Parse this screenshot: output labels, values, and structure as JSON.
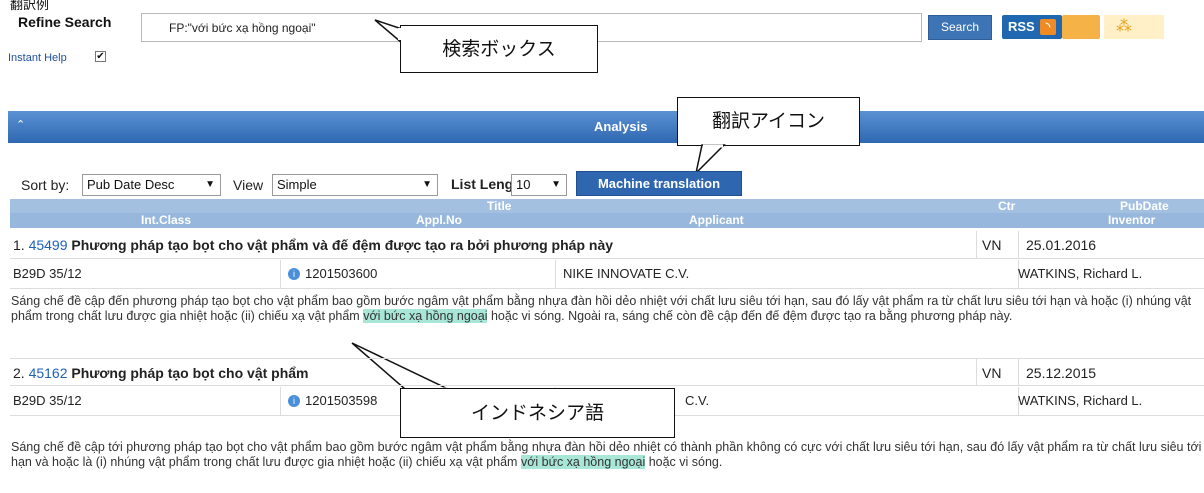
{
  "top_caption": "翻訳例",
  "search": {
    "label": "Refine Search",
    "query": "FP:\"với bức xạ hồng ngoại\"",
    "button": "Search",
    "rss_label": "RSS",
    "rss_glyph": "rss-icon",
    "tree_glyph": "tree-icon",
    "instant_help": "Instant Help",
    "instant_help_checked": "✔"
  },
  "callouts": {
    "search_box": "検索ボックス",
    "translate_icon": "翻訳アイコン",
    "language": "インドネシア語"
  },
  "analysis": {
    "title": "Analysis",
    "chevron": "⌃"
  },
  "toolbar": {
    "sort_label": "Sort by:",
    "sort_value": "Pub Date Desc",
    "view_label": "View",
    "view_value": "Simple",
    "list_length_label": "List Length",
    "list_length_value": "10",
    "machine_translation": "Machine translation",
    "dropdown_glyph": "▼"
  },
  "columns": {
    "title": "Title",
    "ctr": "Ctr",
    "pubdate": "PubDate",
    "intclass": "Int.Class",
    "applno": "Appl.No",
    "applicant": "Applicant",
    "inventor": "Inventor"
  },
  "results": [
    {
      "index": "1.",
      "number": "45499",
      "title": "Phương pháp tạo bọt cho vật phẩm và đế đệm được tạo ra bởi phương pháp này",
      "ctr": "VN",
      "pubdate": "25.01.2016",
      "intclass": "B29D 35/12",
      "applno": "1201503600",
      "applicant": "NIKE INNOVATE C.V.",
      "inventor": "WATKINS, Richard L.",
      "abstract_a": "Sáng chế đề cập đến phương pháp tạo bọt cho vật phẩm bao gồm bước ngâm vật phẩm bằng nhựa đàn hồi dẻo nhiệt với chất lưu siêu tới hạn, sau đó lấy vật phẩm ra từ chất lưu siêu tới hạn và hoặc (i) nhúng vật phẩm trong chất lưu được gia nhiệt hoặc (ii) chiếu xạ vật phẩm ",
      "abstract_hl": "với bức xạ hồng ngoại",
      "abstract_b": " hoặc vi sóng. Ngoài ra, sáng chế còn đề cập đến đế đệm được tạo ra bằng phương pháp này."
    },
    {
      "index": "2.",
      "number": "45162",
      "title": "Phương pháp tạo bọt cho vật phẩm",
      "ctr": "VN",
      "pubdate": "25.12.2015",
      "intclass": "B29D 35/12",
      "applno": "1201503598",
      "applicant": "C.V.",
      "inventor": "WATKINS, Richard L.",
      "abstract_a": "Sáng chế đề cập tới phương pháp tạo bọt cho vật phẩm bao gồm bước ngâm vật phẩm bằng nhựa đàn hồi dẻo nhiệt có thành phần không có cực với chất lưu siêu tới hạn, sau đó lấy vật phẩm ra từ chất lưu siêu tới hạn và hoặc là (i) nhúng vật phẩm trong chất lưu được gia nhiệt hoặc (ii) chiếu xạ vật phẩm ",
      "abstract_hl": "với bức xạ hồng ngoại",
      "abstract_b": " hoặc vi sóng."
    }
  ]
}
